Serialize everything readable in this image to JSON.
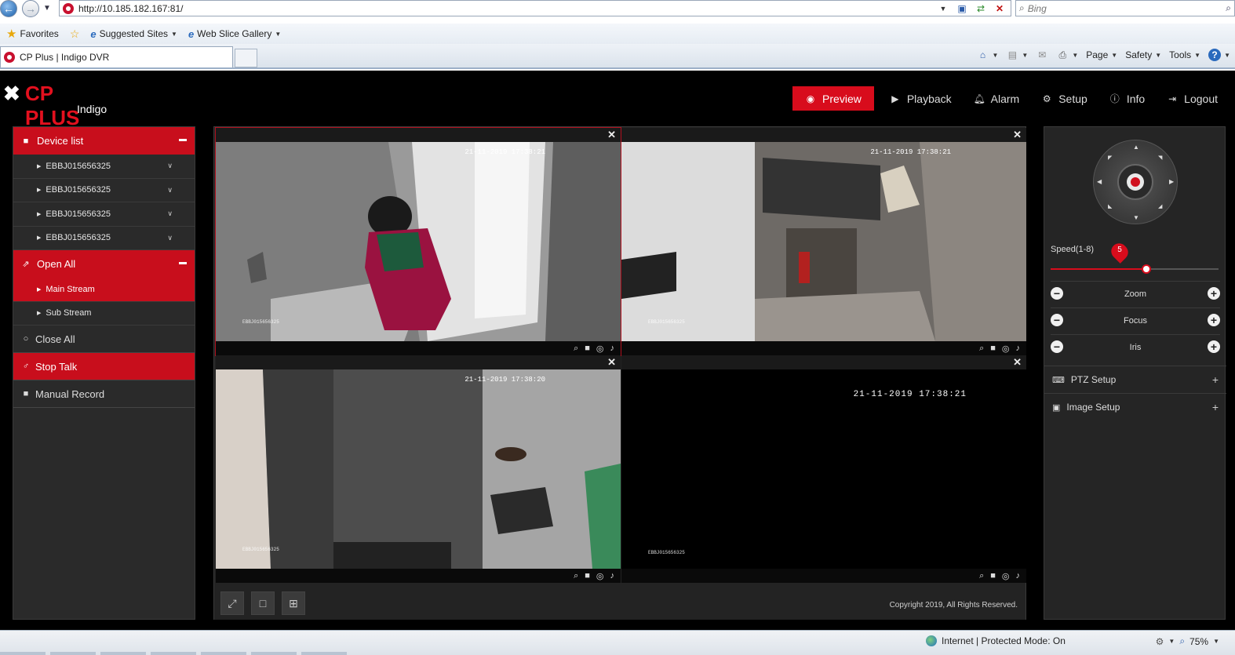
{
  "browser": {
    "url": "http://10.185.182.167:81/",
    "search_placeholder": "Bing",
    "favorites_label": "Favorites",
    "fav_links": [
      "Suggested Sites",
      "Web Slice Gallery"
    ],
    "tab_title": "CP Plus | Indigo DVR",
    "commands": [
      "Page",
      "Safety",
      "Tools"
    ],
    "status_text": "Internet | Protected Mode: On",
    "zoom": "75%"
  },
  "app": {
    "brand": "CP PLUS",
    "subbrand": "Indigo",
    "nav": [
      {
        "label": "Preview",
        "icon": "eye-icon",
        "active": true
      },
      {
        "label": "Playback",
        "icon": "play-circle-icon"
      },
      {
        "label": "Alarm",
        "icon": "bell-icon"
      },
      {
        "label": "Setup",
        "icon": "gear-icon"
      },
      {
        "label": "Info",
        "icon": "info-icon"
      },
      {
        "label": "Logout",
        "icon": "logout-icon"
      }
    ]
  },
  "left_panel": {
    "device_list_label": "Device list",
    "devices": [
      "EBBJ015656325",
      "EBBJ015656325",
      "EBBJ015656325",
      "EBBJ015656325"
    ],
    "open_all_label": "Open All",
    "streams": [
      "Main Stream",
      "Sub Stream"
    ],
    "close_all_label": "Close All",
    "stop_talk_label": "Stop Talk",
    "manual_record_label": "Manual Record"
  },
  "video": {
    "cells": [
      {
        "time": "21-11-2019 17:38:21",
        "name": "EBBJ015656325"
      },
      {
        "time": "21-11-2019 17:38:21",
        "name": "EBBJ015656325"
      },
      {
        "time": "21-11-2019 17:38:20",
        "name": "EBBJ015656325"
      },
      {
        "time": "21-11-2019 17:38:21",
        "name": "EBBJ015656325"
      }
    ],
    "copyright": "Copyright 2019, All Rights Reserved."
  },
  "ptz": {
    "speed_label": "Speed(1-8)",
    "speed_value": "5",
    "speed_fraction": 0.57,
    "controls": [
      "Zoom",
      "Focus",
      "Iris"
    ],
    "ptz_setup_label": "PTZ Setup",
    "image_setup_label": "Image Setup"
  },
  "colors": {
    "accent": "#d80c1c",
    "panel": "#2a2a2a",
    "background": "#000000"
  }
}
